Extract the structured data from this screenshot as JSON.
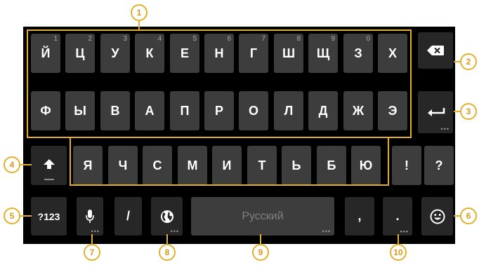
{
  "keyboard": {
    "row1": [
      {
        "label": "Й",
        "hint": "1"
      },
      {
        "label": "Ц",
        "hint": "2"
      },
      {
        "label": "У",
        "hint": "3"
      },
      {
        "label": "К",
        "hint": "4"
      },
      {
        "label": "Е",
        "hint": "5"
      },
      {
        "label": "Н",
        "hint": "6"
      },
      {
        "label": "Г",
        "hint": "7"
      },
      {
        "label": "Ш",
        "hint": "8"
      },
      {
        "label": "Щ",
        "hint": "9"
      },
      {
        "label": "З",
        "hint": "0"
      },
      {
        "label": "Х",
        "hint": ""
      }
    ],
    "row2": [
      "Ф",
      "Ы",
      "В",
      "А",
      "П",
      "Р",
      "О",
      "Л",
      "Д",
      "Ж",
      "Э"
    ],
    "row3": [
      "Я",
      "Ч",
      "С",
      "М",
      "И",
      "Т",
      "Ь",
      "Б",
      "Ю"
    ],
    "row3_extra": [
      "!",
      "?"
    ],
    "bottom": {
      "symbols_label": "?123",
      "slash_label": "/",
      "space_label": "Русский",
      "comma_label": ",",
      "period_label": "."
    },
    "icons": {
      "backspace": "backspace-icon",
      "enter": "enter-icon",
      "shift": "shift-arrow-icon",
      "mic": "microphone-icon",
      "globe": "globe-icon",
      "emoji": "emoji-smile-icon"
    }
  },
  "callouts": [
    "1",
    "2",
    "3",
    "4",
    "5",
    "6",
    "7",
    "8",
    "9",
    "10"
  ],
  "colors": {
    "annotation": "#e3b02a",
    "key": "#3d3d3d",
    "key_dark": "#272727",
    "background": "#000000"
  }
}
